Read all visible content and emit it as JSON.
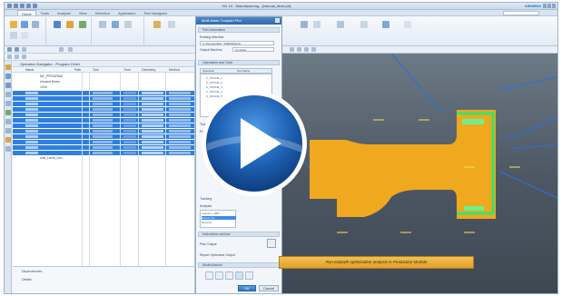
{
  "window": {
    "app_title": "NX 10 - Manufacturing - [manual_Maxi.prt]",
    "brand": "SIEMENS"
  },
  "ribbon_tabs": [
    "Home",
    "Tools",
    "Analysis",
    "View",
    "Selection",
    "Application",
    "Part Navigator"
  ],
  "navigator": {
    "title": "Operation Navigator - Program Order",
    "columns": [
      "Name",
      "Path",
      "Tool",
      "Time",
      "Geometry",
      "Method"
    ],
    "rows": [
      {
        "name": "NC_PROGRAM",
        "selected": false
      },
      {
        "name": "Unused Items",
        "selected": false
      },
      {
        "name": "1234",
        "selected": false
      },
      {
        "name": "",
        "selected": true
      },
      {
        "name": "",
        "selected": true
      },
      {
        "name": "",
        "selected": true
      },
      {
        "name": "",
        "selected": true
      },
      {
        "name": "",
        "selected": true
      },
      {
        "name": "",
        "selected": true
      },
      {
        "name": "",
        "selected": true
      },
      {
        "name": "",
        "selected": true
      },
      {
        "name": "",
        "selected": true
      },
      {
        "name": "",
        "selected": true
      },
      {
        "name": "",
        "selected": true
      },
      {
        "name": "",
        "selected": true
      },
      {
        "name": "Unit_Level_Leo...",
        "selected": false
      }
    ],
    "details_label": "Dependencies",
    "details_value": "Details"
  },
  "dialog": {
    "title": "Multi-blade Toolpath Plot",
    "section1": "Part Information",
    "field1_label": "Existing Machine",
    "field1_value": "C:\\Users\\public\\...\\DMG5MACH",
    "field2_label": "Output Machine",
    "field2_value": "Template",
    "section2": "Operations and Tools",
    "list_header": "Operation",
    "list_header2": "Tool Name",
    "list_rows": [
      "C_SPLINE_1",
      "C_SPLINE_2",
      "C_SPLINE_3",
      "C_SPLINE_4",
      "C_SPLINE_5"
    ],
    "side_labels": [
      "Toolpath",
      "Feed",
      "Tracking",
      "Analysis"
    ],
    "bottom_list": [
      "Insertion_1800",
      "Export_Pro",
      "Resume"
    ],
    "section3": "Instructions window",
    "field3_label": "Plan Output",
    "field4_label": "Report Optimized Output",
    "section4": "Model Actions",
    "ok_label": "OK",
    "cancel_label": "Cancel"
  },
  "caption": "Run toolpath optimization analysis in Production Module",
  "colors": {
    "part_orange": "#f0a81e",
    "toolpath_green": "#36e36a",
    "selection_blue": "#2f7fe0",
    "play_blue": "#1d5fb0"
  }
}
